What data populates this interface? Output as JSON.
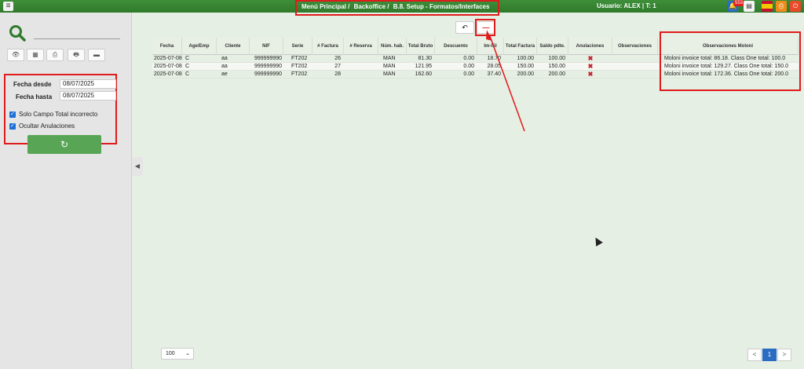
{
  "topbar": {
    "menu_icon": "hamburger-icon",
    "breadcrumb": [
      "Menú Principal /",
      "Backoffice /",
      "B.8. Setup - Formatos/Interfaces"
    ],
    "user": "Usuario: ALEX | T: 1",
    "notif_count": "553"
  },
  "left": {
    "fecha_desde_label": "Fecha desde",
    "fecha_desde_value": "08/07/2025",
    "fecha_hasta_label": "Fecha hasta",
    "fecha_hasta_value": "08/07/2025",
    "solo_campo_label": "Solo Campo Total incorrecto",
    "ocultar_label": "Ocultar Anulaciones",
    "refresh_symbol": "↻"
  },
  "toolbar": {
    "undo_symbol": "↶",
    "minus_symbol": "—"
  },
  "table": {
    "headers": [
      "Fecha",
      "Age/Emp",
      "Cliente",
      "NIF",
      "Serie",
      "# Factura",
      "# Reserva",
      "Núm. hab.",
      "Total Bruto",
      "Descuento",
      "Im-ISI",
      "Total Factura",
      "Saldo pdte.",
      "Anulaciones",
      "Observaciones",
      "Observaciones Moloni"
    ],
    "rows": [
      [
        "2025-07-08",
        "C",
        "aa",
        "999999990",
        "FT202",
        "26",
        "",
        "MAN",
        "81.30",
        "0.00",
        "18.70",
        "100.00",
        "100.00",
        "✖",
        "",
        "Moloni invoice total: 86.18. Class One total: 100.0"
      ],
      [
        "2025-07-08",
        "C",
        "aa",
        "999999990",
        "FT202",
        "27",
        "",
        "MAN",
        "121.95",
        "0.00",
        "28.05",
        "150.00",
        "150.00",
        "✖",
        "",
        "Moloni invoice total: 129.27. Class One total: 150.0"
      ],
      [
        "2025-07-08",
        "C",
        "ae",
        "999999990",
        "FT202",
        "28",
        "",
        "MAN",
        "162.60",
        "0.00",
        "37.40",
        "200.00",
        "200.00",
        "✖",
        "",
        "Moloni invoice total: 172.36. Class One total: 200.0"
      ]
    ]
  },
  "footer": {
    "page_size": "100",
    "prev": "<",
    "page": "1",
    "next": ">"
  },
  "colors": {
    "topbar": "#2f7a2b",
    "highlight": "#e01b1b",
    "button_green": "#58a556",
    "page_bg": "#e6efe3"
  }
}
